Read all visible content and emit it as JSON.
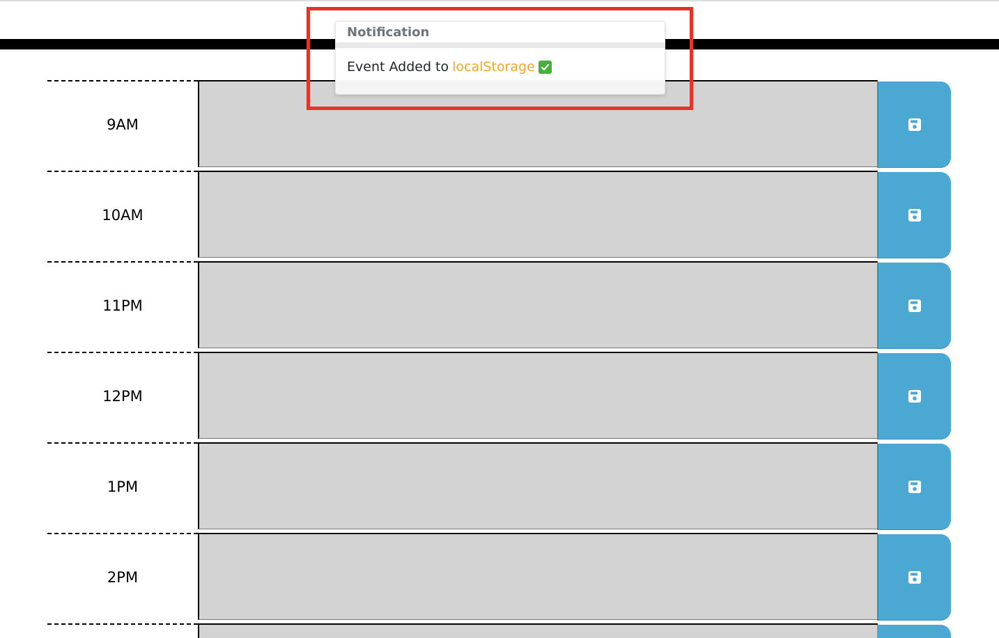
{
  "notification": {
    "title": "Notification",
    "message_prefix": "Event Added to",
    "message_highlight": "localStorage",
    "status_icon": "check-icon",
    "highlight_color": "#f5a623"
  },
  "timeblocks": [
    {
      "hour": "9AM",
      "description": ""
    },
    {
      "hour": "10AM",
      "description": ""
    },
    {
      "hour": "11PM",
      "description": ""
    },
    {
      "hour": "12PM",
      "description": ""
    },
    {
      "hour": "1PM",
      "description": ""
    },
    {
      "hour": "2PM",
      "description": ""
    }
  ],
  "save_icon": "save-icon",
  "colors": {
    "row_background": "#d3d3d3",
    "save_button": "#4aa8d3",
    "annotation_box": "#e63329"
  }
}
